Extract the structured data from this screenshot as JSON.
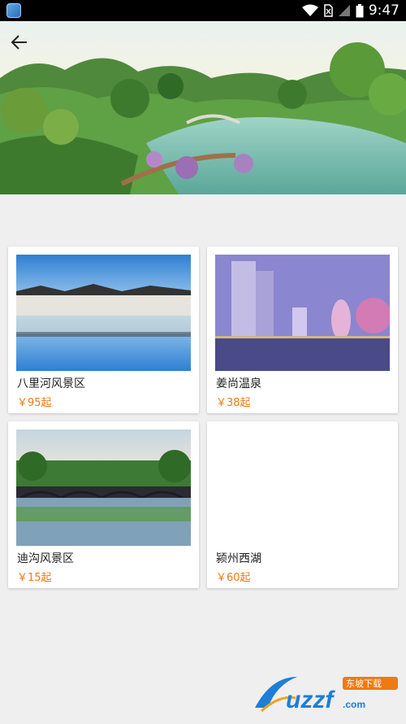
{
  "status_bar": {
    "time": "9:47"
  },
  "header": {
    "back_icon": "arrow-left-icon"
  },
  "colors": {
    "price": "#f07a12",
    "background": "#efefef",
    "card": "#ffffff"
  },
  "attractions": [
    {
      "name": "八里河风景区",
      "price": "￥95起"
    },
    {
      "name": "姜尚温泉",
      "price": "￥38起"
    },
    {
      "name": "迪沟风景区",
      "price": "￥15起"
    },
    {
      "name": "颍州西湖",
      "price": "￥60起"
    }
  ],
  "watermark": {
    "text": "uzzf.com",
    "badge": "东坡下载"
  }
}
